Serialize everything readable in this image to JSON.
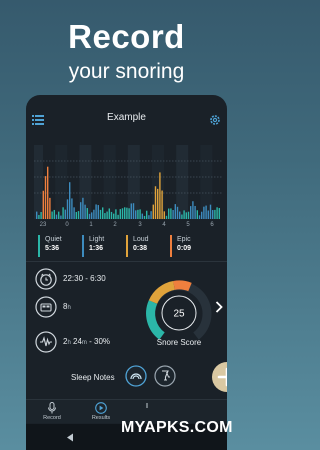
{
  "promo": {
    "headline": "Record",
    "subheadline": "your snoring"
  },
  "app": {
    "title": "Example",
    "chart_data": {
      "type": "bar",
      "x_ticks": [
        "23",
        "0",
        "1",
        "2",
        "3",
        "4",
        "5",
        "6"
      ],
      "grid": true,
      "categories": {
        "quiet": {
          "label": "Quiet",
          "value": "5:36",
          "color": "#2bb6a8"
        },
        "light": {
          "label": "Light",
          "value": "1:36",
          "color": "#3d8cbf"
        },
        "loud": {
          "label": "Loud",
          "value": "0:38",
          "color": "#e0a33b"
        },
        "epic": {
          "label": "Epic",
          "value": "0:09",
          "color": "#ef7f3e"
        }
      }
    },
    "stats": {
      "time_range": "22:30 - 6:30",
      "sleep_hours": "8",
      "sleep_hours_unit": "h",
      "snore_h": "2",
      "snore_h_unit": "h",
      "snore_m": " 24",
      "snore_m_unit": "m",
      "snore_pct": " - 30%"
    },
    "snore_score": {
      "value": "25",
      "label": "Snore Score"
    },
    "sleep_notes_label": "Sleep Notes",
    "nav": {
      "record": "Record",
      "results": "Results"
    }
  },
  "watermark": "MYAPKS.COM"
}
